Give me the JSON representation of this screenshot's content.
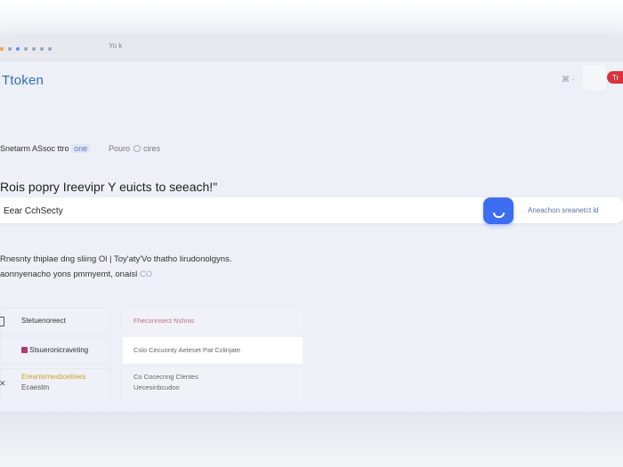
{
  "window": {
    "title": "Yo k"
  },
  "header": {
    "logo": "Ttoken",
    "icon_label": "⌘ ·",
    "button_label": "Tr"
  },
  "tabs": [
    {
      "label_plain": "Snetarm ASsoc",
      "label_highlight": "ttro",
      "label_tail": "one"
    },
    {
      "label": "Pouro",
      "suffix": "cires"
    }
  ],
  "headline": "Rois popry Ireevipr Y euicts to seeach!\"",
  "search": {
    "value": "Eear CchSecty",
    "advanced_link": "Aneachon sreanetct ld"
  },
  "description": {
    "line1": "Rnesnty thiplae dng sliing  Ol | Toy'aty'Vo thatho lirudonolgyns.",
    "line2": "aonnyenacho yons pmmyemt, onaisl",
    "line2_tail": "CO"
  },
  "cards": [
    {
      "left": "Stetuenoreect",
      "right": "Fheconnsect Nshnis"
    },
    {
      "left": "Stsueronicraveting",
      "right": "Cslo Cecuonty Aeteset Pat Cclinjate"
    },
    {
      "left_line1": "Ereanlsmesboetiees",
      "left_line2": "Ecaestm",
      "right_line1": "Co   Cocecnng Clentes",
      "right_line2": "Uecesinbcudoo"
    }
  ],
  "colors": {
    "brand": "#2f6fb5",
    "primary_button": "#3d6df0",
    "danger": "#d9333b"
  }
}
